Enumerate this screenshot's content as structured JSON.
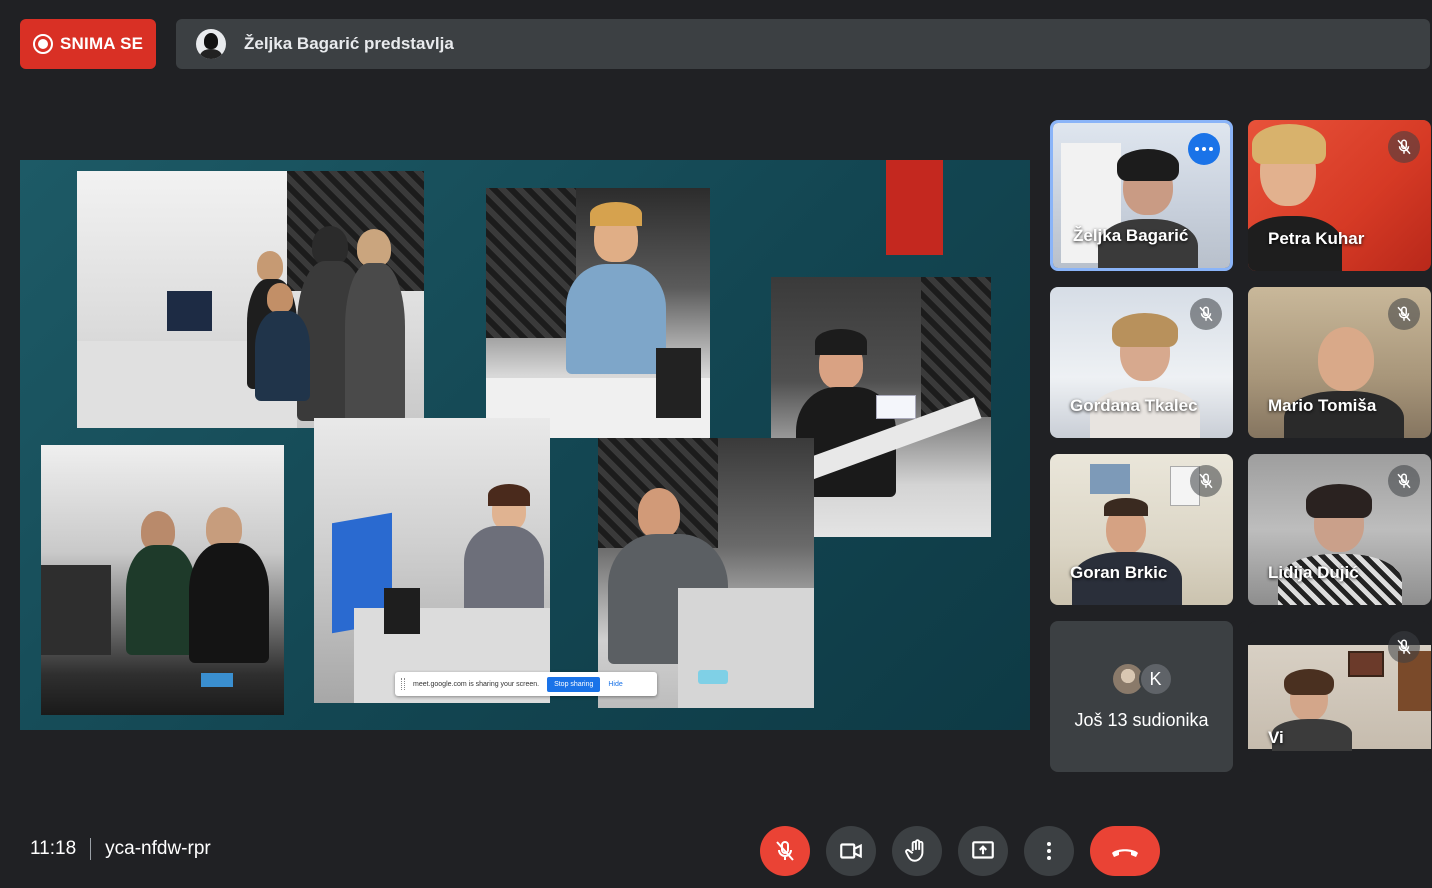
{
  "recording": {
    "label": "SNIMA SE",
    "color": "#d93025"
  },
  "presenter_banner": {
    "text": "Željka Bagarić predstavlja"
  },
  "presentation": {
    "share_bar": {
      "message": "meet.google.com is sharing your screen.",
      "stop_label": "Stop sharing",
      "hide_label": "Hide"
    }
  },
  "participants": [
    {
      "name": "Željka Bagarić",
      "muted": false,
      "active": true
    },
    {
      "name": "Petra Kuhar",
      "muted": true
    },
    {
      "name": "Gordana Tkalec",
      "muted": true
    },
    {
      "name": "Mario Tomiša",
      "muted": true
    },
    {
      "name": "Goran Brkic",
      "muted": true
    },
    {
      "name": "Lidija Dujić",
      "muted": true
    },
    {
      "name": "Vi",
      "muted": true
    }
  ],
  "more_participants": {
    "avatar_letter": "K",
    "label": "Još 13 sudionika"
  },
  "footer": {
    "time": "11:18",
    "meeting_code": "yca-nfdw-rpr"
  },
  "controls": [
    "mic-off-icon",
    "camera-icon",
    "raise-hand-icon",
    "present-icon",
    "more-options-icon",
    "hang-up-icon"
  ]
}
